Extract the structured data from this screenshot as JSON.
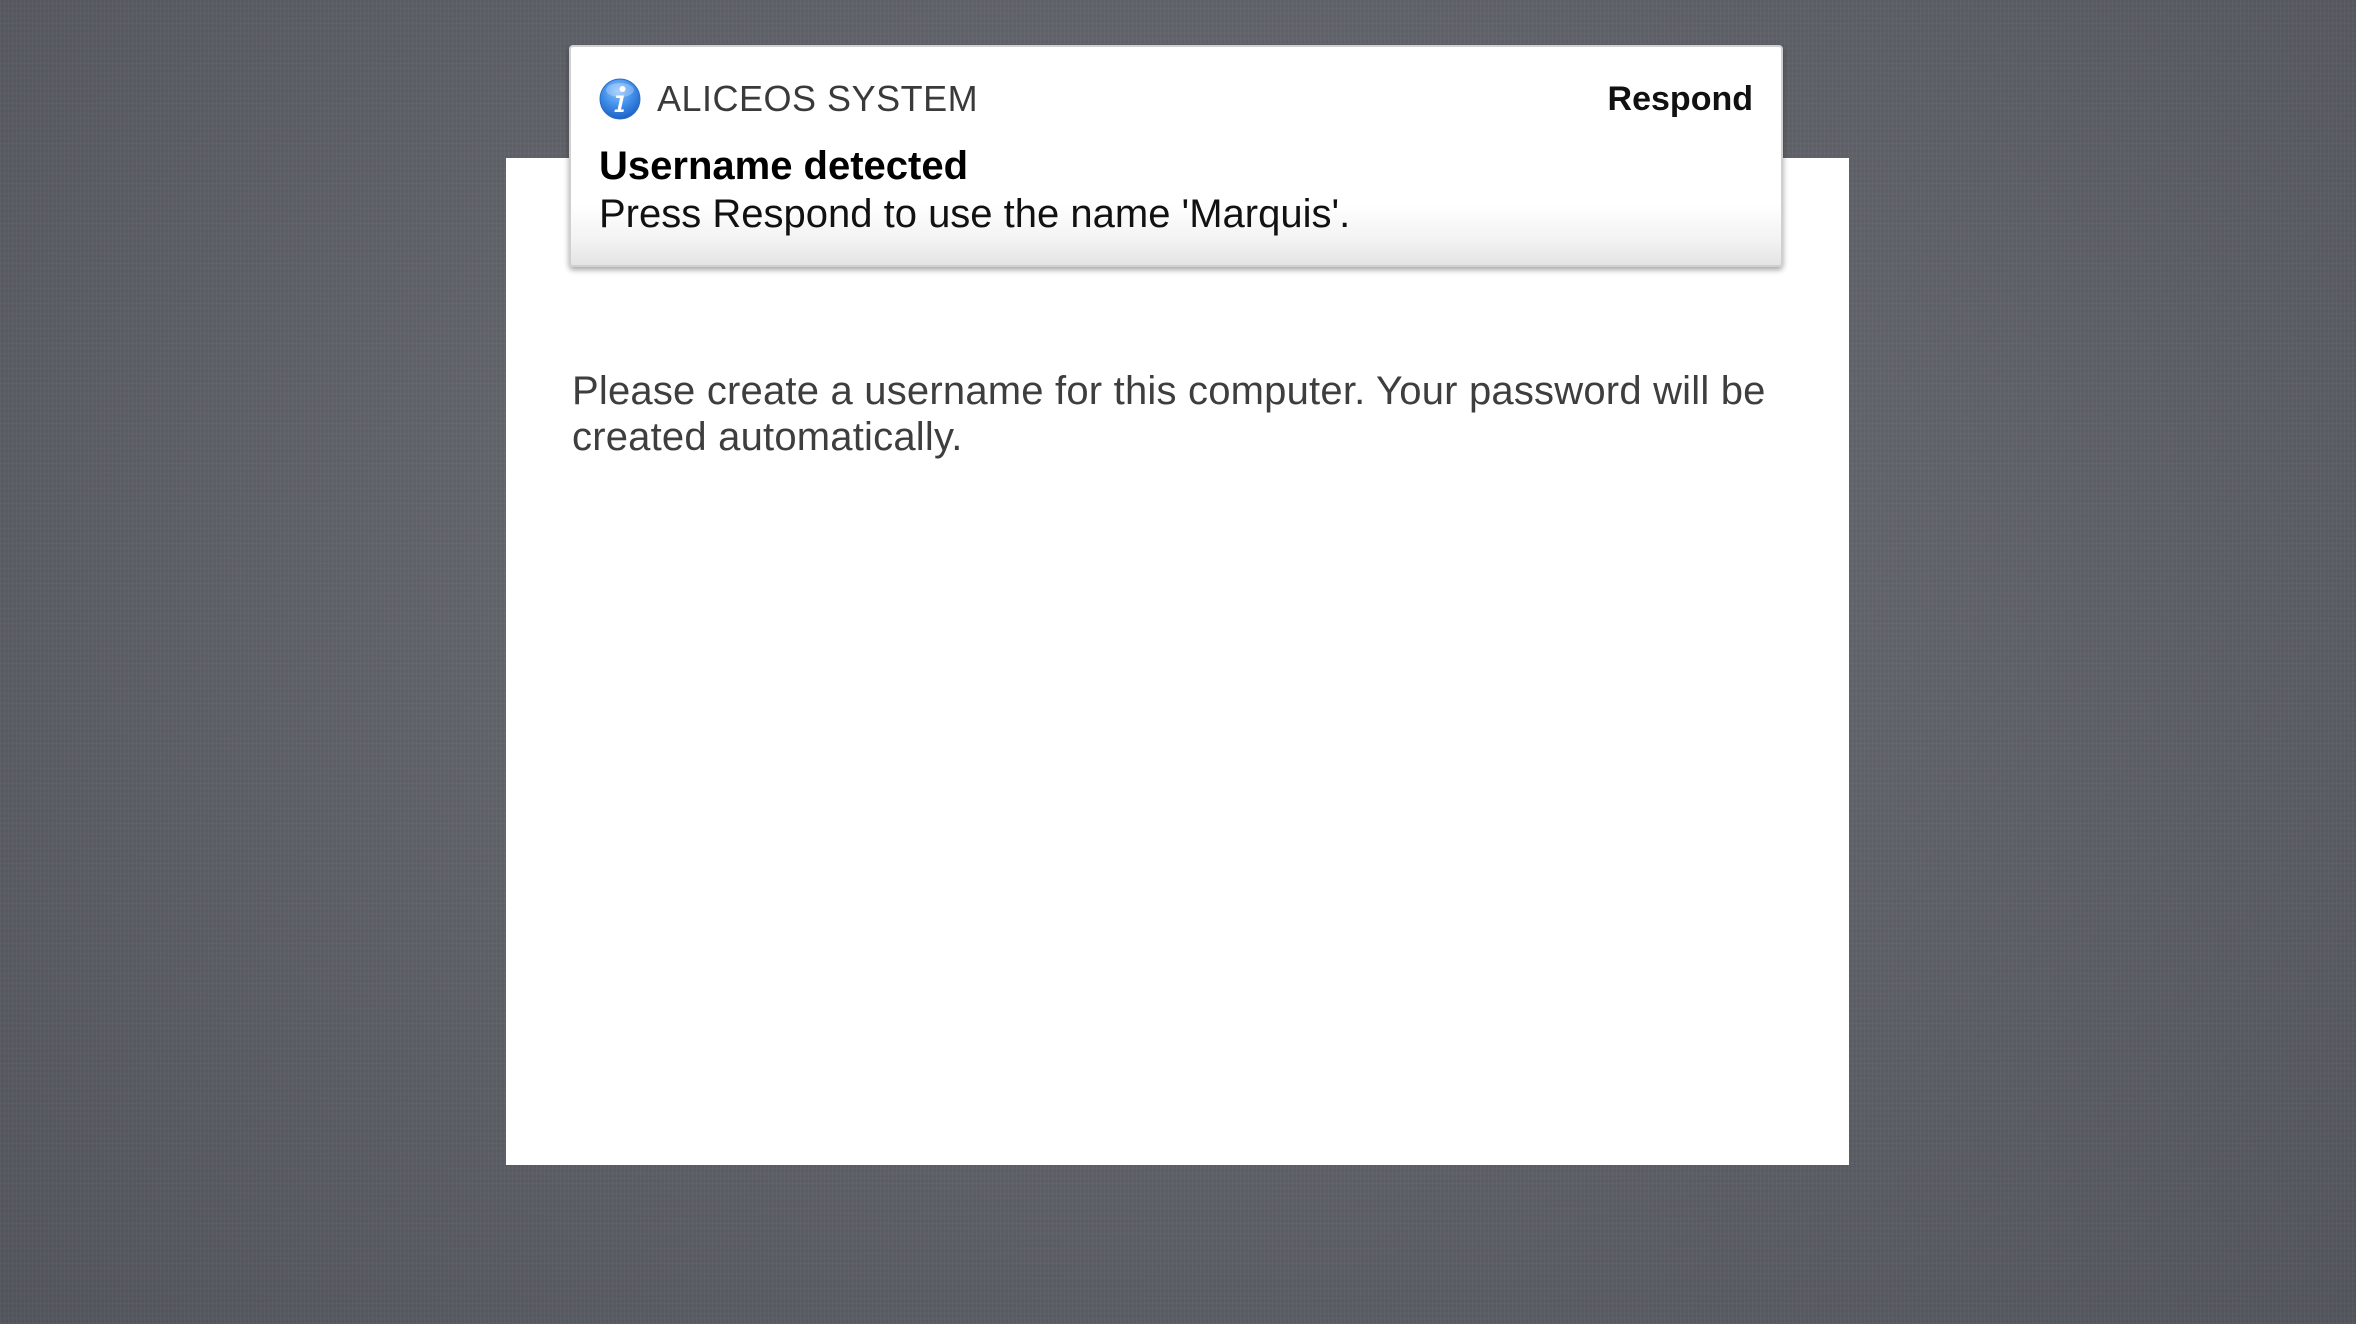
{
  "setup": {
    "prompt": "Please create a username for this computer. Your password will be created automatically."
  },
  "notification": {
    "app_icon": "info-icon",
    "app_name": "ALICEOS SYSTEM",
    "action_label": "Respond",
    "title": "Username detected",
    "body": "Press Respond to use the name 'Marquis'."
  },
  "colors": {
    "desktop_background": "#5f6169",
    "panel_background": "#ffffff",
    "info_icon_blue": "#3f8ee8"
  }
}
